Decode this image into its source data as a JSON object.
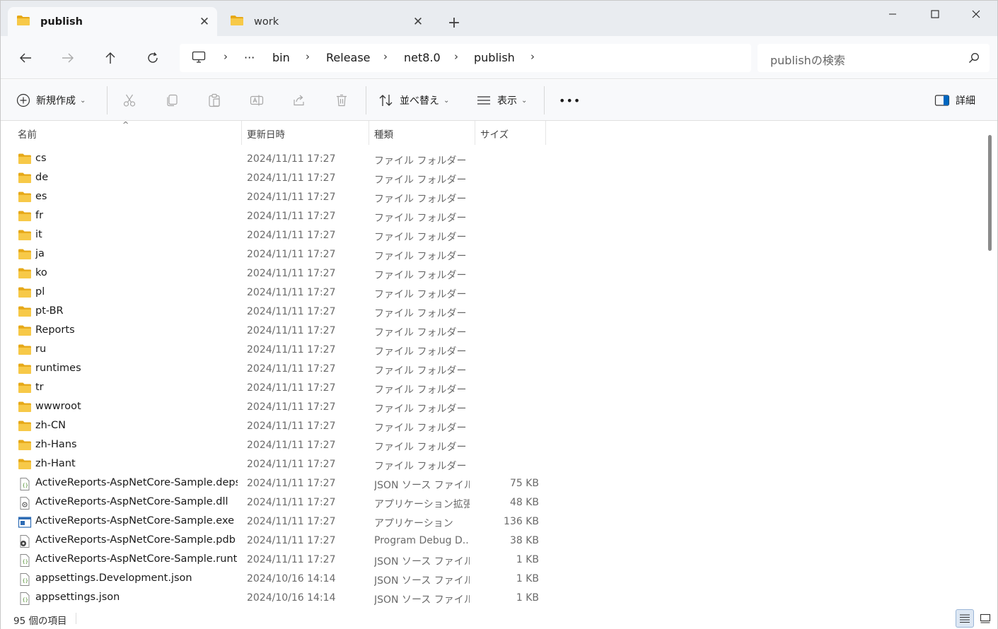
{
  "tabs": [
    {
      "label": "publish",
      "active": true
    },
    {
      "label": "work",
      "active": false
    }
  ],
  "window": {
    "close_tab_glyph": "✕",
    "new_tab_glyph": "+"
  },
  "breadcrumb": {
    "overflow": "···",
    "items": [
      "bin",
      "Release",
      "net8.0",
      "publish"
    ]
  },
  "search": {
    "placeholder": "publishの検索"
  },
  "commands": {
    "new": "新規作成",
    "sort": "並べ替え",
    "view": "表示",
    "more": "•••",
    "details": "詳細"
  },
  "columns": {
    "name": "名前",
    "modified": "更新日時",
    "type": "種類",
    "size": "サイズ"
  },
  "files": [
    {
      "name": "cs",
      "modified": "2024/11/11 17:27",
      "type": "ファイル フォルダー",
      "size": "",
      "icon": "folder-icon"
    },
    {
      "name": "de",
      "modified": "2024/11/11 17:27",
      "type": "ファイル フォルダー",
      "size": "",
      "icon": "folder-icon"
    },
    {
      "name": "es",
      "modified": "2024/11/11 17:27",
      "type": "ファイル フォルダー",
      "size": "",
      "icon": "folder-icon"
    },
    {
      "name": "fr",
      "modified": "2024/11/11 17:27",
      "type": "ファイル フォルダー",
      "size": "",
      "icon": "folder-icon"
    },
    {
      "name": "it",
      "modified": "2024/11/11 17:27",
      "type": "ファイル フォルダー",
      "size": "",
      "icon": "folder-icon"
    },
    {
      "name": "ja",
      "modified": "2024/11/11 17:27",
      "type": "ファイル フォルダー",
      "size": "",
      "icon": "folder-icon"
    },
    {
      "name": "ko",
      "modified": "2024/11/11 17:27",
      "type": "ファイル フォルダー",
      "size": "",
      "icon": "folder-icon"
    },
    {
      "name": "pl",
      "modified": "2024/11/11 17:27",
      "type": "ファイル フォルダー",
      "size": "",
      "icon": "folder-icon"
    },
    {
      "name": "pt-BR",
      "modified": "2024/11/11 17:27",
      "type": "ファイル フォルダー",
      "size": "",
      "icon": "folder-icon"
    },
    {
      "name": "Reports",
      "modified": "2024/11/11 17:27",
      "type": "ファイル フォルダー",
      "size": "",
      "icon": "folder-icon"
    },
    {
      "name": "ru",
      "modified": "2024/11/11 17:27",
      "type": "ファイル フォルダー",
      "size": "",
      "icon": "folder-icon"
    },
    {
      "name": "runtimes",
      "modified": "2024/11/11 17:27",
      "type": "ファイル フォルダー",
      "size": "",
      "icon": "folder-icon"
    },
    {
      "name": "tr",
      "modified": "2024/11/11 17:27",
      "type": "ファイル フォルダー",
      "size": "",
      "icon": "folder-icon"
    },
    {
      "name": "wwwroot",
      "modified": "2024/11/11 17:27",
      "type": "ファイル フォルダー",
      "size": "",
      "icon": "folder-icon"
    },
    {
      "name": "zh-CN",
      "modified": "2024/11/11 17:27",
      "type": "ファイル フォルダー",
      "size": "",
      "icon": "folder-icon"
    },
    {
      "name": "zh-Hans",
      "modified": "2024/11/11 17:27",
      "type": "ファイル フォルダー",
      "size": "",
      "icon": "folder-icon"
    },
    {
      "name": "zh-Hant",
      "modified": "2024/11/11 17:27",
      "type": "ファイル フォルダー",
      "size": "",
      "icon": "folder-icon"
    },
    {
      "name": "ActiveReports-AspNetCore-Sample.deps....",
      "modified": "2024/11/11 17:27",
      "type": "JSON ソース ファイル",
      "size": "75 KB",
      "icon": "json-file-icon"
    },
    {
      "name": "ActiveReports-AspNetCore-Sample.dll",
      "modified": "2024/11/11 17:27",
      "type": "アプリケーション拡張",
      "size": "48 KB",
      "icon": "dll-file-icon"
    },
    {
      "name": "ActiveReports-AspNetCore-Sample.exe",
      "modified": "2024/11/11 17:27",
      "type": "アプリケーション",
      "size": "136 KB",
      "icon": "exe-file-icon"
    },
    {
      "name": "ActiveReports-AspNetCore-Sample.pdb",
      "modified": "2024/11/11 17:27",
      "type": "Program Debug D...",
      "size": "38 KB",
      "icon": "pdb-file-icon"
    },
    {
      "name": "ActiveReports-AspNetCore-Sample.runti...",
      "modified": "2024/11/11 17:27",
      "type": "JSON ソース ファイル",
      "size": "1 KB",
      "icon": "json-file-icon"
    },
    {
      "name": "appsettings.Development.json",
      "modified": "2024/10/16 14:14",
      "type": "JSON ソース ファイル",
      "size": "1 KB",
      "icon": "json-file-icon"
    },
    {
      "name": "appsettings.json",
      "modified": "2024/10/16 14:14",
      "type": "JSON ソース ファイル",
      "size": "1 KB",
      "icon": "json-file-icon"
    }
  ],
  "status": {
    "item_count": "95 個の項目"
  },
  "colors": {
    "folder": "#f4c542",
    "folder_dark": "#e6a817",
    "accent": "#0067c0"
  }
}
